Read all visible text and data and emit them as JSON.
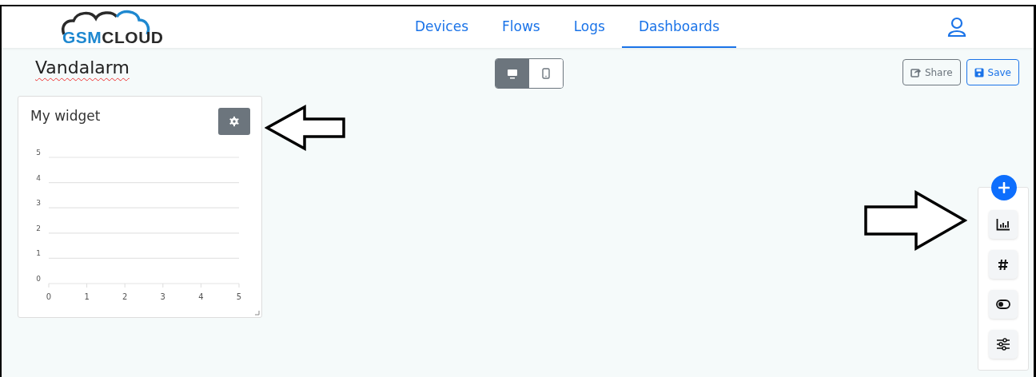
{
  "logo": {
    "part_1": "GSM",
    "part_2": "CLOUD"
  },
  "nav": [
    {
      "label": "Devices",
      "selected": false
    },
    {
      "label": "Flows",
      "selected": false
    },
    {
      "label": "Logs",
      "selected": false
    },
    {
      "label": "Dashboards",
      "selected": true
    }
  ],
  "dashboard": {
    "title": "Vandalarm"
  },
  "view_toggle": [
    {
      "kind": "desktop",
      "selected": true
    },
    {
      "kind": "mobile",
      "selected": false
    }
  ],
  "actions": [
    {
      "kind": "share",
      "label": "Share"
    },
    {
      "kind": "save",
      "label": "Save"
    }
  ],
  "widget": {
    "title": "My widget",
    "chart_data": {
      "type": "line",
      "xlim": [
        0,
        5
      ],
      "ylim": [
        0,
        5
      ],
      "xticks": [
        0,
        1,
        2,
        3,
        4,
        5
      ],
      "yticks": [
        0,
        1,
        2,
        3,
        4,
        5
      ],
      "grid": true
    }
  },
  "palette": [
    {
      "kind": "chart"
    },
    {
      "kind": "number"
    },
    {
      "kind": "toggle"
    },
    {
      "kind": "sliders"
    }
  ]
}
